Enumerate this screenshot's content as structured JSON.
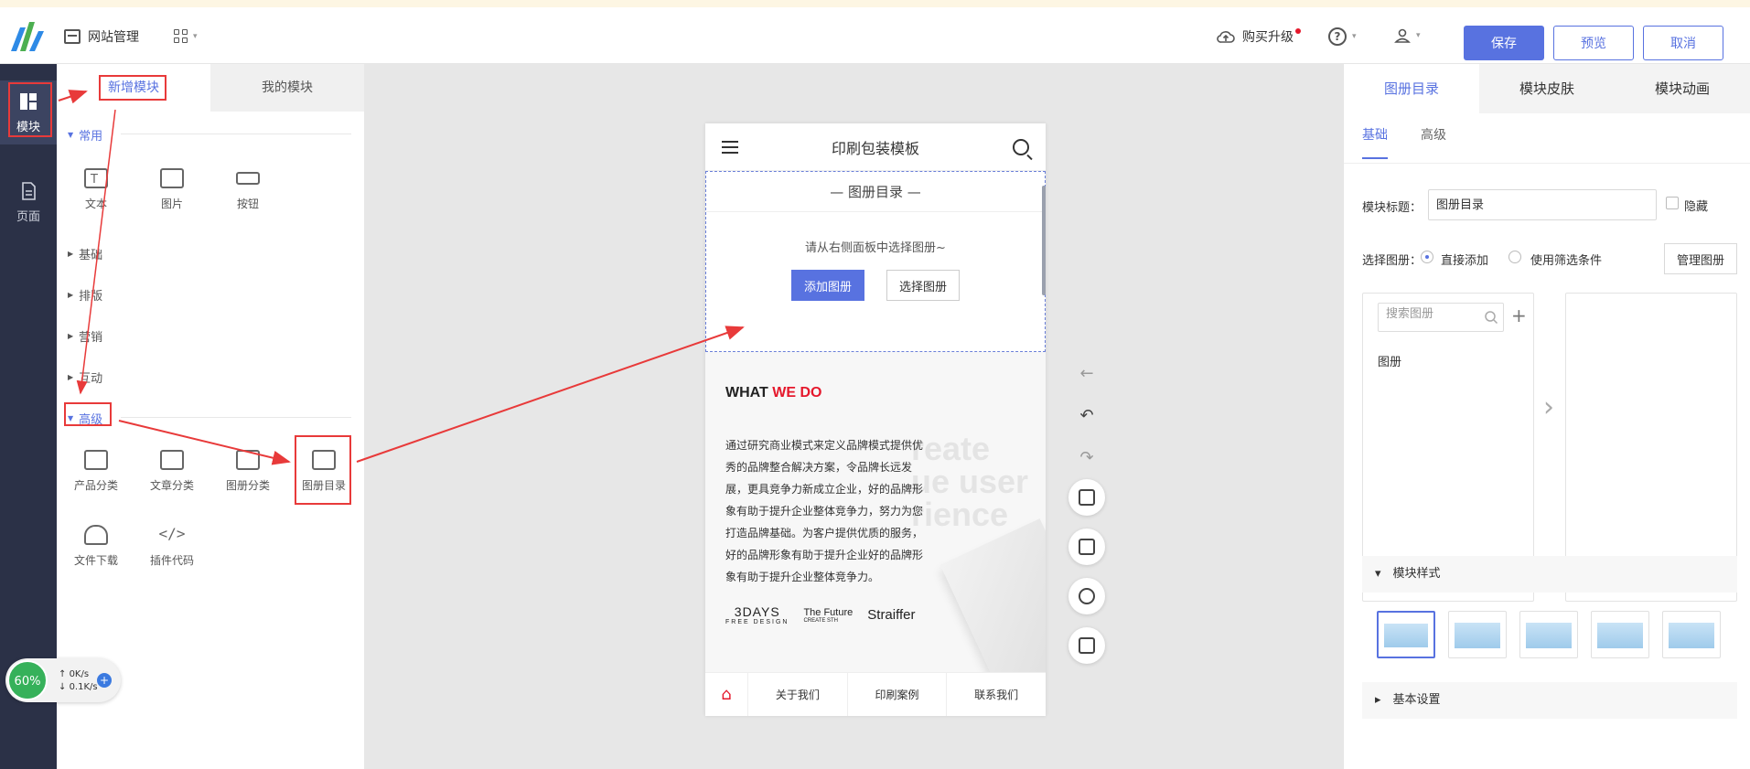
{
  "header": {
    "site_management": "网站管理",
    "upgrade": "购买升级",
    "save": "保存",
    "preview": "预览",
    "cancel": "取消"
  },
  "sidebar": {
    "items": [
      {
        "label": "模块"
      },
      {
        "label": "页面"
      }
    ]
  },
  "module_panel": {
    "tabs": [
      "新增模块",
      "我的模块"
    ],
    "categories": {
      "common": "常用",
      "basic": "基础",
      "layout": "排版",
      "marketing": "营销",
      "interact": "互动",
      "advanced": "高级"
    },
    "common_modules": [
      "文本",
      "图片",
      "按钮"
    ],
    "advanced_modules": [
      "产品分类",
      "文章分类",
      "图册分类",
      "图册目录",
      "文件下载",
      "插件代码"
    ]
  },
  "phone": {
    "title": "印刷包装模板",
    "album_block_title": "图册目录",
    "album_tip": "请从右侧面板中选择图册~",
    "add_album": "添加图册",
    "choose_album": "选择图册",
    "what_we_do_a": "WHAT",
    "what_we_do_b": "WE DO",
    "ghost_text": "reate\nue user\nrience",
    "paragraph": "通过研究商业模式来定义品牌模式提供优秀的品牌整合解决方案，令品牌长远发展，更具竞争力新成立企业，好的品牌形象有助于提升企业整体竞争力，努力为您打造品牌基础。为客户提供优质的服务，好的品牌形象有助于提升企业好的品牌形象有助于提升企业整体竞争力。",
    "brands": [
      "3DAYS",
      "The Future",
      "Straiffer"
    ],
    "brand_sub": [
      "FREE DESIGN",
      "CREATE STH"
    ],
    "nav": [
      "关于我们",
      "印刷案例",
      "联系我们"
    ]
  },
  "right_panel": {
    "tabs": [
      "图册目录",
      "模块皮肤",
      "模块动画"
    ],
    "subtabs": [
      "基础",
      "高级"
    ],
    "title_label": "模块标题：",
    "title_value": "图册目录",
    "hide_label": "隐藏",
    "select_label": "选择图册：",
    "direct_add": "直接添加",
    "use_filter": "使用筛选条件",
    "manage": "管理图册",
    "search_placeholder": "搜索图册",
    "list_item": "图册",
    "style_section": "模块样式",
    "settings_section": "基本设置"
  },
  "speed_widget": {
    "percent": "60%",
    "up": "0K/s",
    "down": "0.1K/s"
  },
  "colors": {
    "accent": "#5872e0",
    "annotation": "#e83a3a",
    "sidebar": "#2b3147"
  }
}
